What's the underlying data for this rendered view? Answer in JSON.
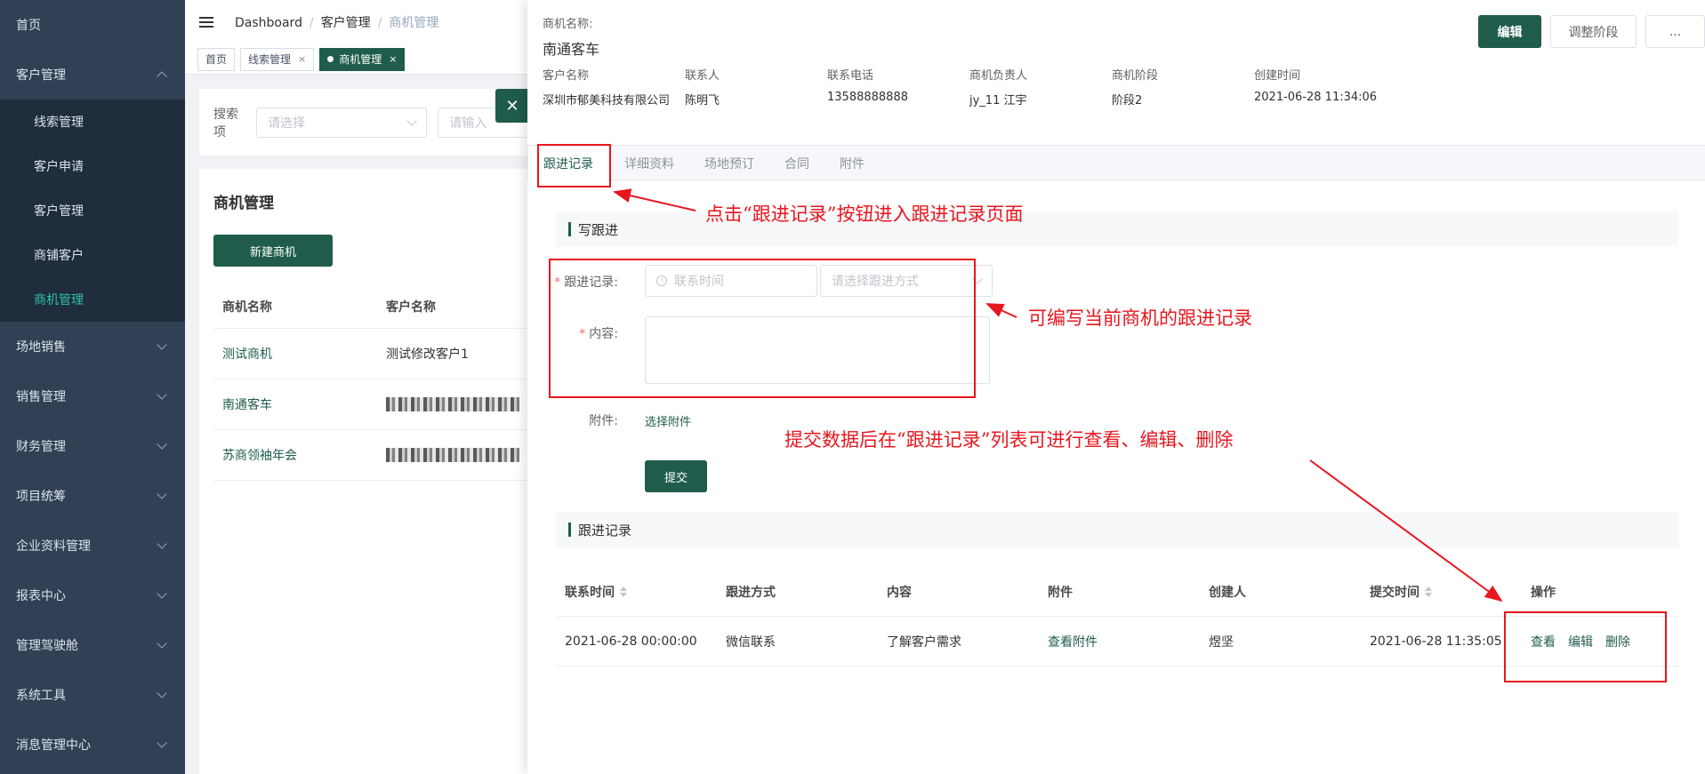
{
  "sidebar": {
    "items": [
      {
        "label": "首页"
      },
      {
        "label": "客户管理"
      },
      {
        "label": "场地销售"
      },
      {
        "label": "销售管理"
      },
      {
        "label": "财务管理"
      },
      {
        "label": "项目统筹"
      },
      {
        "label": "企业资料管理"
      },
      {
        "label": "报表中心"
      },
      {
        "label": "管理驾驶舱"
      },
      {
        "label": "系统工具"
      },
      {
        "label": "消息管理中心"
      }
    ],
    "sub_items": [
      {
        "label": "线索管理"
      },
      {
        "label": "客户申请"
      },
      {
        "label": "客户管理"
      },
      {
        "label": "商铺客户"
      },
      {
        "label": "商机管理"
      }
    ]
  },
  "breadcrumb": [
    "Dashboard",
    "客户管理",
    "商机管理"
  ],
  "tags": [
    {
      "label": "首页"
    },
    {
      "label": "线索管理"
    },
    {
      "label": "商机管理"
    }
  ],
  "search": {
    "label": "搜索项",
    "select_placeholder": "请选择",
    "input_placeholder": "请输入"
  },
  "list": {
    "title": "商机管理",
    "new_button": "新建商机",
    "headers": [
      "商机名称",
      "客户名称"
    ],
    "rows": [
      {
        "name": "测试商机",
        "customer": "测试修改客户1"
      },
      {
        "name": "南通客车",
        "customer": ""
      },
      {
        "name": "苏商领袖年会",
        "customer": ""
      }
    ]
  },
  "drawer": {
    "label": "商机名称:",
    "name": "南通客车",
    "buttons": {
      "edit": "编辑",
      "stage": "调整阶段",
      "more": "..."
    },
    "info": [
      {
        "key": "客户名称",
        "value": "深圳市郁美科技有限公司"
      },
      {
        "key": "联系人",
        "value": "陈明飞"
      },
      {
        "key": "联系电话",
        "value": "13588888888"
      },
      {
        "key": "商机负责人",
        "value": "jy_11 江宇"
      },
      {
        "key": "商机阶段",
        "value": "阶段2"
      },
      {
        "key": "创建时间",
        "value": "2021-06-28 11:34:06"
      }
    ],
    "tabs": [
      "跟进记录",
      "详细资料",
      "场地预订",
      "合同",
      "附件"
    ],
    "form": {
      "section_title": "写跟进",
      "record_label": "跟进记录:",
      "time_placeholder": "联系时间",
      "method_placeholder": "请选择跟进方式",
      "content_label": "内容:",
      "attach_label": "附件:",
      "attach_link": "选择附件",
      "submit": "提交"
    },
    "records": {
      "section_title": "跟进记录",
      "headers": [
        "联系时间",
        "跟进方式",
        "内容",
        "附件",
        "创建人",
        "提交时间",
        "操作"
      ],
      "rows": [
        {
          "time": "2021-06-28 00:00:00",
          "method": "微信联系",
          "content": "了解客户需求",
          "attachment": "查看附件",
          "creator": "煜坚",
          "submitted": "2021-06-28 11:35:05"
        }
      ],
      "actions": [
        "查看",
        "编辑",
        "删除"
      ]
    }
  },
  "annotations": {
    "a1": "点击“跟进记录”按钮进入跟进记录页面",
    "a2": "可编写当前商机的跟进记录",
    "a3": "提交数据后在“跟进记录”列表可进行查看、编辑、删除"
  },
  "colors": {
    "brand": "#1f5c4b",
    "sidebar": "#304156",
    "annotation": "#e8161e"
  }
}
